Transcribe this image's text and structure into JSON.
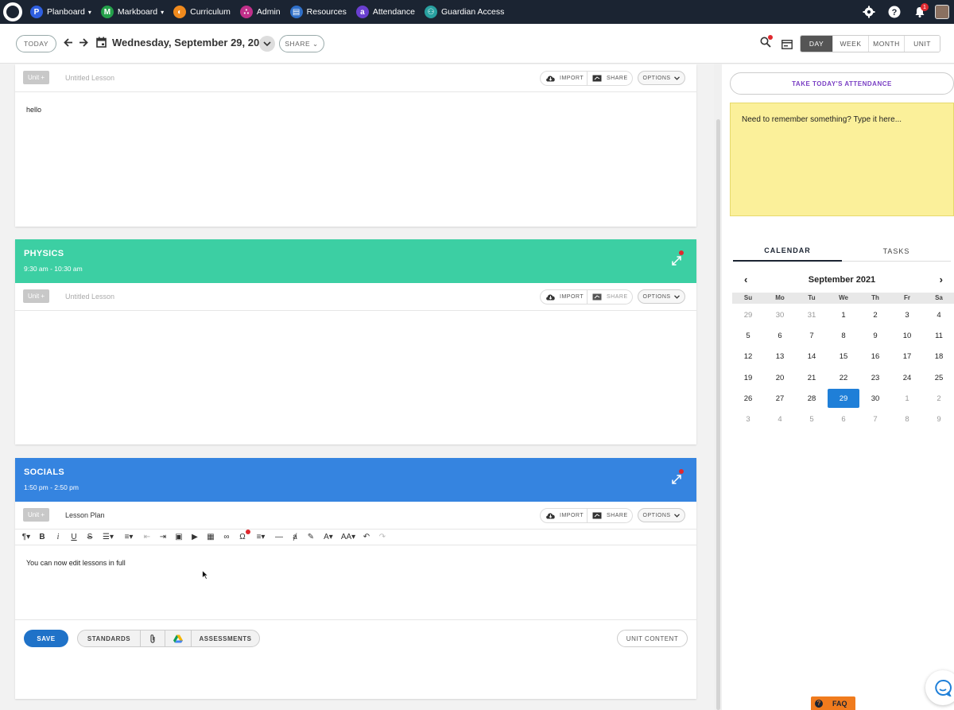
{
  "nav": {
    "items": [
      {
        "label": "Planboard",
        "badge": "P",
        "color": "#2f5fe0",
        "caret": true
      },
      {
        "label": "Markboard",
        "badge": "M",
        "color": "#24a04a",
        "caret": true
      },
      {
        "label": "Curriculum",
        "badge": "◐",
        "color": "#f08a1d",
        "caret": false
      },
      {
        "label": "Admin",
        "badge": "∴",
        "color": "#c0308a",
        "caret": false
      },
      {
        "label": "Resources",
        "badge": "▤",
        "color": "#2f6fc8",
        "caret": false
      },
      {
        "label": "Attendance",
        "badge": "a",
        "color": "#6a3fd0",
        "caret": false
      },
      {
        "label": "Guardian Access",
        "badge": "⚇",
        "color": "#28a0a0",
        "caret": false
      }
    ],
    "notification_count": "1"
  },
  "toolbar": {
    "today_label": "TODAY",
    "date": "Wednesday, September 29, 2021",
    "share_label": "SHARE",
    "views": [
      "DAY",
      "WEEK",
      "MONTH",
      "UNIT"
    ],
    "active_view": "DAY"
  },
  "lessons": {
    "first": {
      "unit_label": "Unit +",
      "title": "Untitled Lesson",
      "import_label": "IMPORT",
      "share_label": "SHARE",
      "options_label": "OPTIONS",
      "body": "hello"
    },
    "physics": {
      "class_name": "PHYSICS",
      "time": "9:30 am - 10:30 am",
      "color": "#3ccfa3",
      "unit_label": "Unit +",
      "title": "Untitled Lesson",
      "import_label": "IMPORT",
      "share_label": "SHARE",
      "options_label": "OPTIONS"
    },
    "socials": {
      "class_name": "SOCIALS",
      "time": "1:50 pm - 2:50 pm",
      "color": "#3584e0",
      "unit_label": "Unit +",
      "title": "Lesson Plan",
      "import_label": "IMPORT",
      "share_label": "SHARE",
      "options_label": "OPTIONS",
      "body": "You can now edit lessons in full",
      "save_label": "SAVE",
      "standards_label": "STANDARDS",
      "assessments_label": "ASSESSMENTS",
      "unit_content_label": "UNIT CONTENT"
    }
  },
  "right": {
    "attendance_label": "TAKE TODAY'S ATTENDANCE",
    "sticky_text": "Need to remember something? Type it here...",
    "tabs": [
      "CALENDAR",
      "TASKS"
    ],
    "active_tab": "CALENDAR",
    "calendar": {
      "month": "September 2021",
      "weekdays": [
        "Su",
        "Mo",
        "Tu",
        "We",
        "Th",
        "Fr",
        "Sa"
      ],
      "weeks": [
        [
          "29",
          "30",
          "31",
          "1",
          "2",
          "3",
          "4"
        ],
        [
          "5",
          "6",
          "7",
          "8",
          "9",
          "10",
          "11"
        ],
        [
          "12",
          "13",
          "14",
          "15",
          "16",
          "17",
          "18"
        ],
        [
          "19",
          "20",
          "21",
          "22",
          "23",
          "24",
          "25"
        ],
        [
          "26",
          "27",
          "28",
          "29",
          "30",
          "1",
          "2"
        ],
        [
          "3",
          "4",
          "5",
          "6",
          "7",
          "8",
          "9"
        ]
      ],
      "selected": "29"
    }
  },
  "faq_label": "FAQ"
}
